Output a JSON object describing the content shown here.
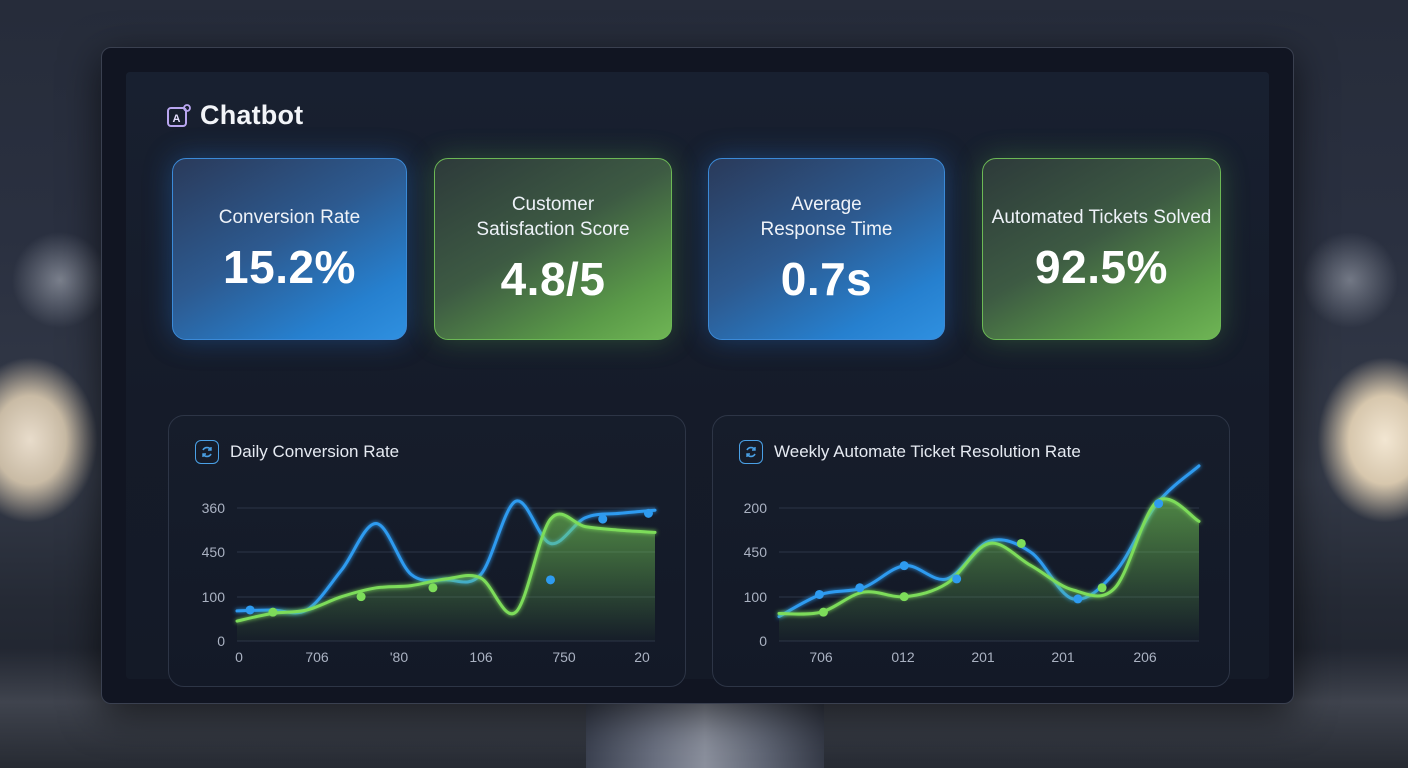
{
  "app": {
    "title": "Chatbot"
  },
  "kpis": [
    {
      "label": "Conversion Rate",
      "value": "15.2%"
    },
    {
      "label": "Customer Satisfaction Score",
      "value": "4.8/5"
    },
    {
      "label": "Average Response Time",
      "value": "0.7s"
    },
    {
      "label": "Automated Tickets Solved",
      "value": "92.5%"
    }
  ],
  "colors": {
    "blue": "#2e9bf0",
    "green": "#7ddc5a",
    "kpi_blue": "#2680cf",
    "kpi_green": "#6fb555"
  },
  "chart_data": [
    {
      "type": "line",
      "title": "Daily Conversion Rate",
      "icon": "refresh-icon",
      "yticks": [
        "360",
        "450",
        "100",
        "0"
      ],
      "xticks": [
        "0",
        "706",
        "'80",
        "106",
        "750",
        "20"
      ],
      "grid": true,
      "series": [
        {
          "values": [
            0.68,
            0.7,
            0.7,
            1.6,
            2.65,
            1.5,
            1.38,
            1.5,
            3.15,
            2.2,
            2.78,
            2.88,
            2.95
          ]
        },
        {
          "values": [
            0.45,
            0.62,
            0.7,
            1.0,
            1.2,
            1.25,
            1.4,
            1.42,
            0.65,
            2.75,
            2.58,
            2.5,
            2.45
          ],
          "fill": true
        }
      ],
      "markers": [
        {
          "series": 0,
          "points": [
            [
              0.2,
              0.7
            ],
            [
              4.8,
              1.38
            ],
            [
              5.6,
              2.75
            ],
            [
              6.3,
              2.88
            ]
          ]
        },
        {
          "series": 1,
          "points": [
            [
              0.55,
              0.65
            ],
            [
              1.9,
              1.0
            ],
            [
              3.0,
              1.2
            ]
          ]
        }
      ]
    },
    {
      "type": "line",
      "title": "Weekly Automate Ticket Resolution Rate",
      "icon": "refresh-icon",
      "yticks": [
        "200",
        "450",
        "100",
        "0"
      ],
      "xticks": [
        "706",
        "012",
        "201",
        "201",
        "206"
      ],
      "grid": true,
      "series": [
        {
          "values": [
            0.55,
            1.05,
            1.2,
            1.7,
            1.4,
            2.25,
            2.0,
            0.95,
            1.55,
            3.1,
            3.95
          ]
        },
        {
          "values": [
            0.62,
            0.65,
            1.1,
            1.0,
            1.3,
            2.2,
            1.7,
            1.15,
            1.2,
            3.15,
            2.7
          ],
          "fill": true
        }
      ],
      "markers": [
        {
          "series": 0,
          "points": [
            [
              0.5,
              1.05
            ],
            [
              1.0,
              1.2
            ],
            [
              1.55,
              1.7
            ],
            [
              2.2,
              1.4
            ],
            [
              3.7,
              0.95
            ],
            [
              4.7,
              3.1
            ]
          ]
        },
        {
          "series": 1,
          "points": [
            [
              0.55,
              0.65
            ],
            [
              1.55,
              1.0
            ],
            [
              3.0,
              2.2
            ],
            [
              4.0,
              1.2
            ]
          ]
        }
      ]
    }
  ]
}
